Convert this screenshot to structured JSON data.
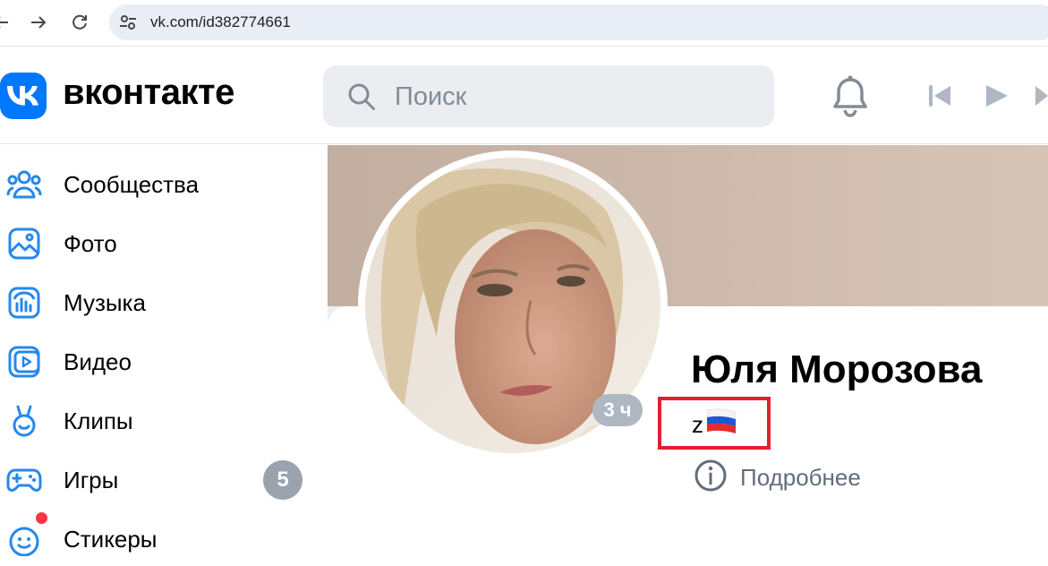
{
  "browser": {
    "url": "vk.com/id382774661"
  },
  "header": {
    "logo_text": "вконтакте",
    "search_placeholder": "Поиск"
  },
  "sidebar": {
    "items": [
      {
        "label": "Сообщества",
        "icon": "communities-icon"
      },
      {
        "label": "Фото",
        "icon": "photo-icon"
      },
      {
        "label": "Музыка",
        "icon": "music-icon"
      },
      {
        "label": "Видео",
        "icon": "video-icon"
      },
      {
        "label": "Клипы",
        "icon": "clips-icon"
      },
      {
        "label": "Игры",
        "icon": "games-icon",
        "badge": "5"
      },
      {
        "label": "Стикеры",
        "icon": "stickers-icon"
      }
    ]
  },
  "profile": {
    "name": "Юля Морозова",
    "status": "z",
    "status_flag": "🇷🇺",
    "online_time": "3 ч",
    "more_info": "Подробнее"
  },
  "colors": {
    "vk_blue": "#0077ff",
    "highlight": "#e0202e",
    "badge_gray": "#99a2ad"
  }
}
